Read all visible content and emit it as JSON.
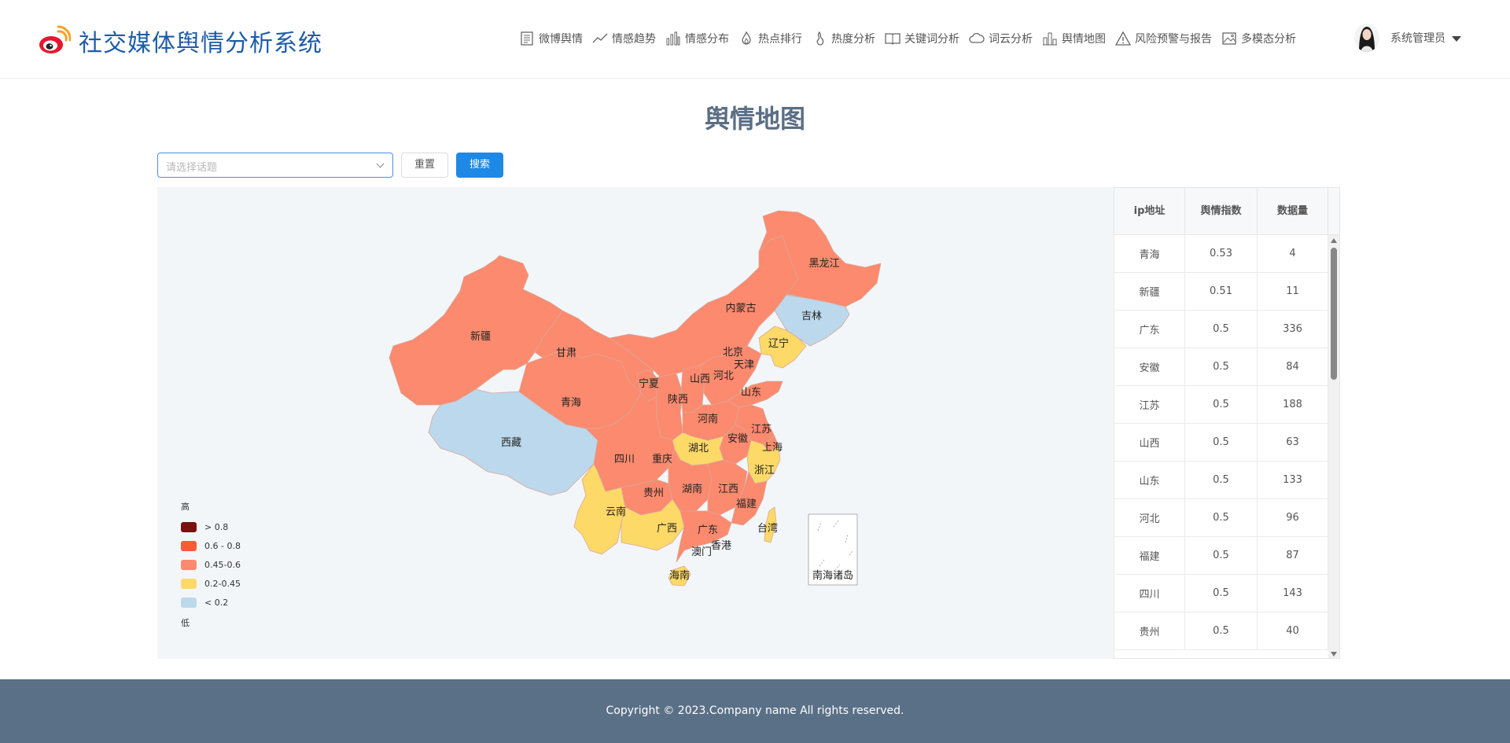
{
  "app": {
    "title": "社交媒体舆情分析系统"
  },
  "nav": {
    "items": [
      {
        "label": "微博舆情",
        "icon": "document-icon"
      },
      {
        "label": "情感趋势",
        "icon": "trend-line-icon"
      },
      {
        "label": "情感分布",
        "icon": "bar-chart-icon"
      },
      {
        "label": "热点排行",
        "icon": "flame-icon"
      },
      {
        "label": "热度分析",
        "icon": "heat-icon"
      },
      {
        "label": "关键词分析",
        "icon": "book-icon"
      },
      {
        "label": "词云分析",
        "icon": "cloud-icon"
      },
      {
        "label": "舆情地图",
        "icon": "map-building-icon"
      },
      {
        "label": "风险预警与报告",
        "icon": "warning-icon"
      },
      {
        "label": "多模态分析",
        "icon": "image-icon"
      }
    ]
  },
  "user": {
    "name": "系统管理员"
  },
  "page": {
    "title": "舆情地图"
  },
  "search": {
    "placeholder": "请选择话题",
    "reset_label": "重置",
    "search_label": "搜索"
  },
  "map": {
    "south_sea_label": "南海诸岛",
    "legend": {
      "high": "高",
      "low": "低",
      "items": [
        {
          "label": "> 0.8",
          "color": "#7a1010"
        },
        {
          "label": "0.6 - 0.8",
          "color": "#ff5a36"
        },
        {
          "label": "0.45-0.6",
          "color": "#fc8a6e"
        },
        {
          "label": "0.2-0.45",
          "color": "#fdd968"
        },
        {
          "label": "< 0.2",
          "color": "#bcd8ec"
        }
      ]
    },
    "province_labels": [
      "黑龙江",
      "内蒙古",
      "吉林",
      "辽宁",
      "新疆",
      "甘肃",
      "北京",
      "天津",
      "宁夏",
      "山西",
      "河北",
      "山东",
      "青海",
      "陕西",
      "河南",
      "江苏",
      "西藏",
      "四川",
      "重庆",
      "湖北",
      "安徽",
      "上海",
      "浙江",
      "贵州",
      "湖南",
      "江西",
      "福建",
      "云南",
      "广西",
      "广东",
      "台湾",
      "香港",
      "澳门",
      "海南"
    ]
  },
  "table": {
    "headers": [
      "ip地址",
      "舆情指数",
      "数据量"
    ],
    "rows": [
      [
        "青海",
        "0.53",
        "4"
      ],
      [
        "新疆",
        "0.51",
        "11"
      ],
      [
        "广东",
        "0.5",
        "336"
      ],
      [
        "安徽",
        "0.5",
        "84"
      ],
      [
        "江苏",
        "0.5",
        "188"
      ],
      [
        "山西",
        "0.5",
        "63"
      ],
      [
        "山东",
        "0.5",
        "133"
      ],
      [
        "河北",
        "0.5",
        "96"
      ],
      [
        "福建",
        "0.5",
        "87"
      ],
      [
        "四川",
        "0.5",
        "143"
      ],
      [
        "贵州",
        "0.5",
        "40"
      ]
    ]
  },
  "footer": {
    "copyright": "Copyright © 2023.Company name All rights reserved."
  },
  "colors": {
    "brand_blue": "#1e5da8",
    "primary_button": "#1e88e5",
    "footer_bg": "#5a7087",
    "map_bg": "#f3f6f9"
  }
}
